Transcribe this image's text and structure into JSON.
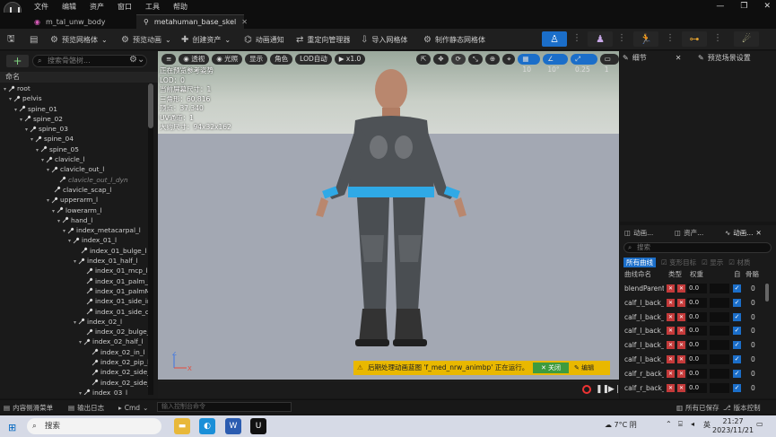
{
  "menu": [
    "文件",
    "编辑",
    "资产",
    "窗口",
    "工具",
    "帮助"
  ],
  "tabs": [
    {
      "label": "m_tal_unw_body",
      "icon": "material-icon"
    },
    {
      "label": "metahuman_base_skel",
      "icon": "skeleton-icon"
    }
  ],
  "toolbar": {
    "preview_mesh": "预览网格体",
    "preview_anim": "预览动画",
    "create_asset": "创建资产",
    "anim_notify": "动画通知",
    "retarget": "重定向管理器",
    "import_mesh": "导入网格体",
    "make_static": "制作静态网格体"
  },
  "skeleton_tree": {
    "search_placeholder": "搜索骨骼树...",
    "column_header": "命名",
    "items": [
      {
        "label": "root",
        "indent": 0,
        "arrow": true
      },
      {
        "label": "pelvis",
        "indent": 1,
        "arrow": true
      },
      {
        "label": "spine_01",
        "indent": 2,
        "arrow": true
      },
      {
        "label": "spine_02",
        "indent": 3,
        "arrow": true
      },
      {
        "label": "spine_03",
        "indent": 4,
        "arrow": true
      },
      {
        "label": "spine_04",
        "indent": 5,
        "arrow": true
      },
      {
        "label": "spine_05",
        "indent": 6,
        "arrow": true
      },
      {
        "label": "clavicle_l",
        "indent": 7,
        "arrow": true
      },
      {
        "label": "clavicle_out_l",
        "indent": 8,
        "arrow": true
      },
      {
        "label": "clavicle_out_l_dyn",
        "indent": 9,
        "arrow": false,
        "dim": true
      },
      {
        "label": "clavicle_scap_l",
        "indent": 8,
        "arrow": false
      },
      {
        "label": "upperarm_l",
        "indent": 8,
        "arrow": true
      },
      {
        "label": "lowerarm_l",
        "indent": 9,
        "arrow": true
      },
      {
        "label": "hand_l",
        "indent": 10,
        "arrow": true
      },
      {
        "label": "index_metacarpal_l",
        "indent": 11,
        "arrow": true
      },
      {
        "label": "index_01_l",
        "indent": 12,
        "arrow": true
      },
      {
        "label": "index_01_bulge_l",
        "indent": 13,
        "arrow": false
      },
      {
        "label": "index_01_half_l",
        "indent": 13,
        "arrow": true
      },
      {
        "label": "index_01_mcp_l",
        "indent": 14,
        "arrow": false
      },
      {
        "label": "index_01_palm_l",
        "indent": 14,
        "arrow": false
      },
      {
        "label": "index_01_palmMid",
        "indent": 14,
        "arrow": false
      },
      {
        "label": "index_01_side_inn",
        "indent": 14,
        "arrow": false
      },
      {
        "label": "index_01_side_out",
        "indent": 14,
        "arrow": false
      },
      {
        "label": "index_02_l",
        "indent": 13,
        "arrow": true
      },
      {
        "label": "index_02_bulge_",
        "indent": 14,
        "arrow": false
      },
      {
        "label": "index_02_half_l",
        "indent": 14,
        "arrow": true
      },
      {
        "label": "index_02_in_l",
        "indent": 15,
        "arrow": false
      },
      {
        "label": "index_02_pip_l",
        "indent": 15,
        "arrow": false
      },
      {
        "label": "index_02_side_ir",
        "indent": 15,
        "arrow": false
      },
      {
        "label": "index_02_side_o",
        "indent": 15,
        "arrow": false
      },
      {
        "label": "index_03_l",
        "indent": 14,
        "arrow": true
      }
    ]
  },
  "viewport": {
    "perspective": "透视",
    "lighting": "光照",
    "show": "显示",
    "character": "角色",
    "lod": "LOD自动",
    "speed": "x1.0",
    "grid": "10",
    "angle": "10°",
    "scale": "0.25",
    "cam": "1",
    "stats": [
      "正在预览参考姿势",
      "LOD：0",
      "当前屏幕尺寸：1",
      "三角形：60,816",
      "顶点：37,340",
      "UV通道：1",
      "大约尺寸：94x32x162"
    ],
    "notice": "后期处理动画蓝图 'f_med_nrw_animbp' 正在运行。",
    "notice_stop": "关闭",
    "notice_edit": "编辑"
  },
  "right_top": {
    "tab1": "细节",
    "tab2": "预览场景设置"
  },
  "right_bottom": {
    "tabs": [
      "动画...",
      "资产...",
      "动画..."
    ],
    "search_placeholder": "搜索",
    "filter_all": "所有曲线",
    "filter_morph": "变形目标",
    "filter_show": "显示",
    "filter_material": "材质",
    "col_name": "曲线命名",
    "col_type": "类型",
    "col_weight": "权重",
    "col_auto": "自",
    "col_bone": "骨骼",
    "curves": [
      {
        "name": "blendParent",
        "value": "0.0",
        "bones": "0"
      },
      {
        "name": "calf_l_back_",
        "value": "0.0",
        "bones": "0"
      },
      {
        "name": "calf_l_back_",
        "value": "0.0",
        "bones": "0"
      },
      {
        "name": "calf_l_back_",
        "value": "0.0",
        "bones": "0"
      },
      {
        "name": "calf_l_back_",
        "value": "0.0",
        "bones": "0"
      },
      {
        "name": "calf_l_back_",
        "value": "0.0",
        "bones": "0"
      },
      {
        "name": "calf_r_back_",
        "value": "0.0",
        "bones": "0"
      },
      {
        "name": "calf_r_back_",
        "value": "0.0",
        "bones": "0"
      }
    ]
  },
  "statusbar": {
    "content_drawer": "内容侧滑菜单",
    "output_log": "输出日志",
    "cmd": "Cmd",
    "cmd_placeholder": "输入控制台命令",
    "saved": "所有已保存",
    "version": "版本控制"
  },
  "taskbar": {
    "search": "搜索",
    "weather": "7°C 阴",
    "ime": "英",
    "time": "21:27",
    "date": "2023/11/21"
  }
}
